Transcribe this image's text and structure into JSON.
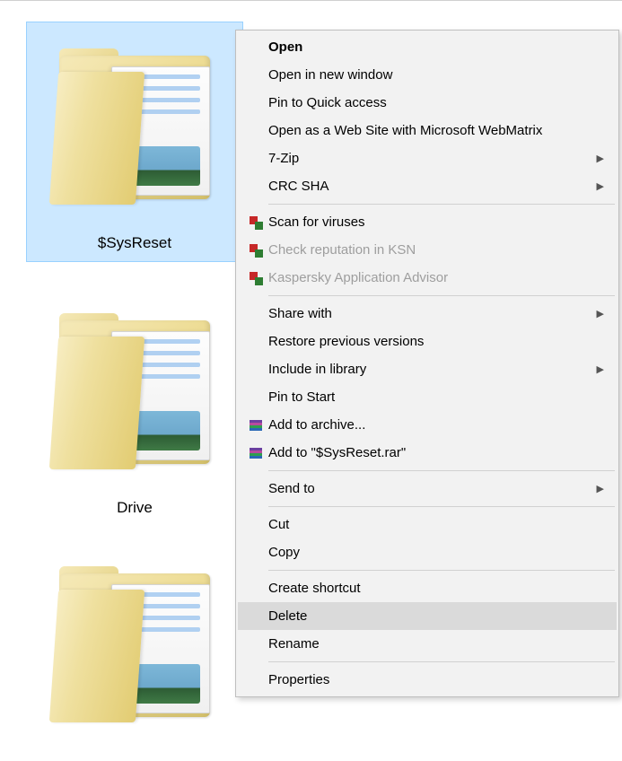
{
  "folders": {
    "item0": {
      "label": "$SysReset"
    },
    "item1": {
      "label": "Drive"
    },
    "item2": {
      "label": ""
    }
  },
  "menu": {
    "open": "Open",
    "open_new_window": "Open in new window",
    "pin_quick_access": "Pin to Quick access",
    "open_webmatrix": "Open as a Web Site with Microsoft WebMatrix",
    "seven_zip": "7-Zip",
    "crc_sha": "CRC SHA",
    "scan_viruses": "Scan for viruses",
    "check_ksn": "Check reputation in KSN",
    "kaspersky_advisor": "Kaspersky Application Advisor",
    "share_with": "Share with",
    "restore_versions": "Restore previous versions",
    "include_library": "Include in library",
    "pin_start": "Pin to Start",
    "add_archive": "Add to archive...",
    "add_rar": "Add to \"$SysReset.rar\"",
    "send_to": "Send to",
    "cut": "Cut",
    "copy": "Copy",
    "create_shortcut": "Create shortcut",
    "delete": "Delete",
    "rename": "Rename",
    "properties": "Properties"
  }
}
